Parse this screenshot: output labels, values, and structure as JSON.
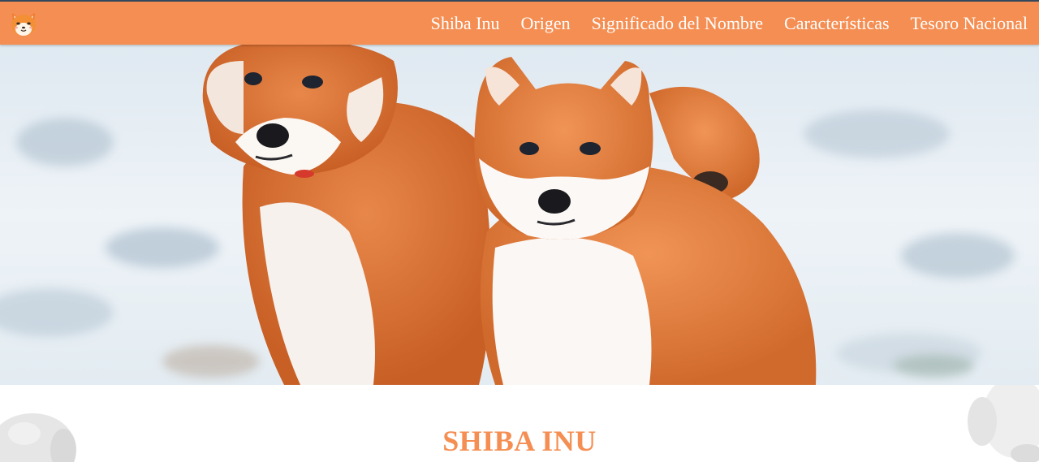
{
  "nav": {
    "logo_icon": "shiba-face-icon",
    "links": [
      {
        "label": "Shiba Inu"
      },
      {
        "label": "Origen"
      },
      {
        "label": "Significado del Nombre"
      },
      {
        "label": "Características"
      },
      {
        "label": "Tesoro Nacional"
      }
    ]
  },
  "hero": {
    "image": "two-shiba-inu-dogs-in-snow"
  },
  "main": {
    "title": "SHIBA INU"
  },
  "colors": {
    "accent": "#f58e52",
    "topline": "#34495e",
    "nav_text": "#ffffff"
  }
}
